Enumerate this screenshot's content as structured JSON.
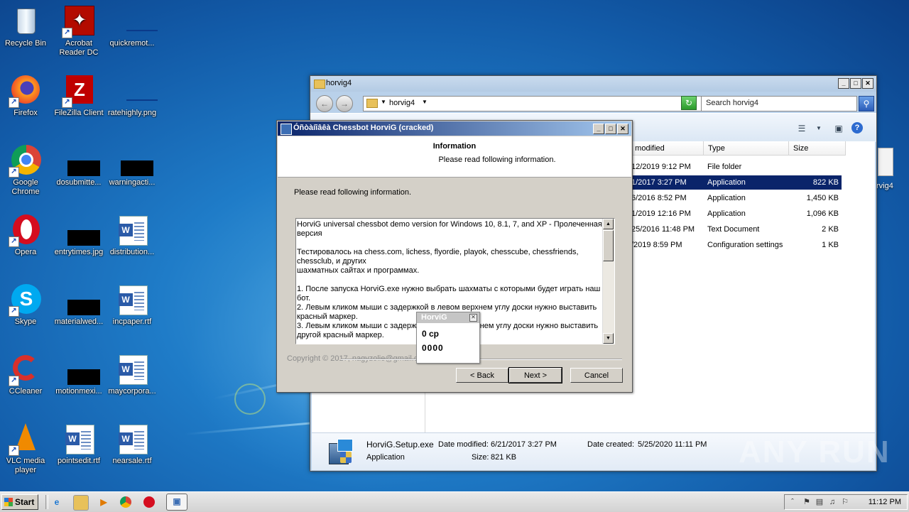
{
  "desktop": {
    "icons": [
      {
        "label": "Recycle Bin",
        "icon": "recycle-bin-icon"
      },
      {
        "label": "Acrobat Reader DC",
        "label_line1": "Acrobat",
        "label_line2": "Reader DC",
        "icon": "acrobat-icon"
      },
      {
        "label": "quickremot...",
        "icon": "file-icon"
      },
      {
        "label": "Firefox",
        "icon": "firefox-icon"
      },
      {
        "label": "FileZilla Client",
        "icon": "filezilla-icon"
      },
      {
        "label": "ratehighly.png",
        "icon": "image-file-icon"
      },
      {
        "label": "Google Chrome",
        "label_line1": "Google",
        "label_line2": "Chrome",
        "icon": "chrome-icon"
      },
      {
        "label": "dosubmitte...",
        "icon": "file-icon"
      },
      {
        "label": "warningacti...",
        "icon": "file-icon"
      },
      {
        "label": "Opera",
        "icon": "opera-icon"
      },
      {
        "label": "entrytimes.jpg",
        "icon": "image-file-icon"
      },
      {
        "label": "distribution...",
        "icon": "word-doc-icon"
      },
      {
        "label": "Skype",
        "icon": "skype-icon"
      },
      {
        "label": "materialwed...",
        "icon": "file-icon"
      },
      {
        "label": "incpaper.rtf",
        "icon": "word-doc-icon"
      },
      {
        "label": "CCleaner",
        "icon": "ccleaner-icon"
      },
      {
        "label": "motionmexi...",
        "icon": "file-icon"
      },
      {
        "label": "maycorpora...",
        "icon": "word-doc-icon"
      },
      {
        "label": "VLC media player",
        "label_line1": "VLC media",
        "label_line2": "player",
        "icon": "vlc-icon"
      },
      {
        "label": "pointsedit.rtf",
        "icon": "word-doc-icon"
      },
      {
        "label": "nearsale.rtf",
        "icon": "word-doc-icon"
      }
    ],
    "edge_item_label": "rvig4"
  },
  "explorer": {
    "title": "horvig4",
    "address": "horvig4",
    "search_placeholder": "Search horvig4",
    "columns": [
      "e modified",
      "Type",
      "Size"
    ],
    "rows": [
      {
        "date": "12/2019 9:12 PM",
        "type": "File folder",
        "size": ""
      },
      {
        "date": "1/2017 3:27 PM",
        "type": "Application",
        "size": "822 KB",
        "selected": true
      },
      {
        "date": "6/2016 8:52 PM",
        "type": "Application",
        "size": "1,450 KB"
      },
      {
        "date": "1/2019 12:16 PM",
        "type": "Application",
        "size": "1,096 KB"
      },
      {
        "date": "25/2016 11:48 PM",
        "type": "Text Document",
        "size": "2 KB"
      },
      {
        "date": "/2019 8:59 PM",
        "type": "Configuration settings",
        "size": "1 KB"
      }
    ],
    "details": {
      "filename": "HorviG.Setup.exe",
      "date_modified_label": "Date modified:",
      "date_modified": "6/21/2017 3:27 PM",
      "date_created_label": "Date created:",
      "date_created": "5/25/2020 11:11 PM",
      "type": "Application",
      "size_label": "Size:",
      "size": "821 KB"
    }
  },
  "dialog": {
    "title": "Óñòàíîâêà Chessbot HorviG (cracked)",
    "header_title": "Information",
    "header_subtitle": "Please read following information.",
    "intro": "Please read following information.",
    "text": {
      "p1": "HorviG universal chessbot demo version for Windows 10, 8.1, 7, and XP - Пролеченная версия",
      "p2a": "Тестировалось на chess.com, lichess, flyordie, playok, chesscube, chessfriends, chessclub, и других",
      "p2b": "шахматных сайтах и программах.",
      "p3": "1. После запуска HorviG.exe нужно выбрать шахматы с которыми будет играть наш бот.",
      "p4": "2. Левым кликом мыши с задержкой в левом верхнем углу доски нужно выставить красный маркер.",
      "p5": "3. Левым кликом мыши с задержкой в правом нижнем углу доски нужно выставить другой красный маркер."
    },
    "copyright": "Copyright © 2017, nagyzolie@gmail.c",
    "back_label": "< Back",
    "next_label": "Next >",
    "cancel_label": "Cancel"
  },
  "popup": {
    "title": "HorviG",
    "line1": "0 cp",
    "line2": "0000"
  },
  "watermark": "ANY RUN",
  "taskbar": {
    "start_label": "Start",
    "clock": "11:12 PM"
  }
}
